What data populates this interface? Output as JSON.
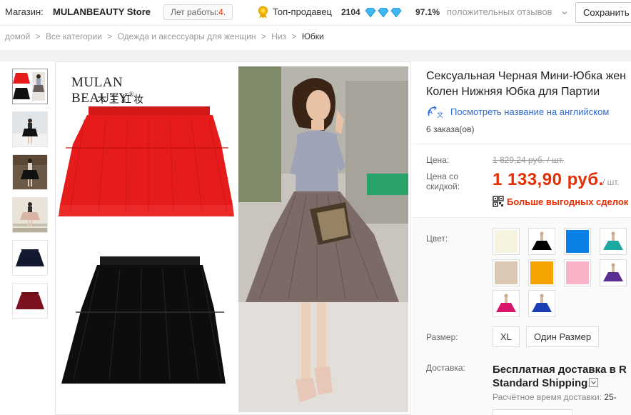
{
  "store": {
    "label": "Магазин:",
    "name": "MULANBEAUTY Store",
    "years_label": "Лет работы:",
    "years_value": "4",
    "years_dot": ".",
    "top_seller": "Топ-продавец",
    "score": "2104",
    "positive_pct": "97.1%",
    "positive_label": "положительных отзывов",
    "save_button": "Сохранить"
  },
  "breadcrumb": {
    "home": "домой",
    "sep": ">",
    "all": "Все категории",
    "women": "Одежда и аксессуары для женщин",
    "bottom": "Низ",
    "current": "Юбки"
  },
  "gallery": {
    "brand": "MULAN BEAUTY",
    "brand_reg": "®",
    "brand_cn": "木兰红妆",
    "thumbs": [
      "red-black-skirts",
      "black-skirt-outdoor",
      "black-skirt-street",
      "pink-skirt-stairs",
      "navy-skirt",
      "burgundy-skirt"
    ]
  },
  "product": {
    "title_line1": "Сексуальная Черная Мини-Юбка жен",
    "title_line2": "Колен Нижняя Юбка для Партии",
    "translate_link": "Посмотреть название на английском",
    "orders": "6 заказа(ов)",
    "price_label": "Цена:",
    "old_price": "1 829,24 руб. / шт.",
    "discount_label_1": "Цена со",
    "discount_label_2": "скидкой:",
    "new_price": "1 133,90 руб.",
    "per_unit": "/ шт.",
    "deals_link": "Больше выгодных сделок"
  },
  "sku": {
    "color_label": "Цвет:",
    "size_label": "Размер:",
    "sizes": [
      "XL",
      "Один Размер"
    ],
    "colors": [
      "#f7f3e1",
      "#000000",
      "#0a7fe6",
      "#1ba8a0",
      "#dbc9b5",
      "#f5a300",
      "#f9b3c6",
      "#5a2d91",
      "#d8166a",
      "#1c3fb3"
    ],
    "shipping_label": "Доставка:",
    "shipping_line1": "Бесплатная доставка в R",
    "shipping_line2": "Standard Shipping",
    "estimate_label": "Расчётное время доставки:",
    "estimate_value": "25-"
  },
  "colors": {
    "accent": "#e62e04",
    "link": "#2e6ad8"
  }
}
